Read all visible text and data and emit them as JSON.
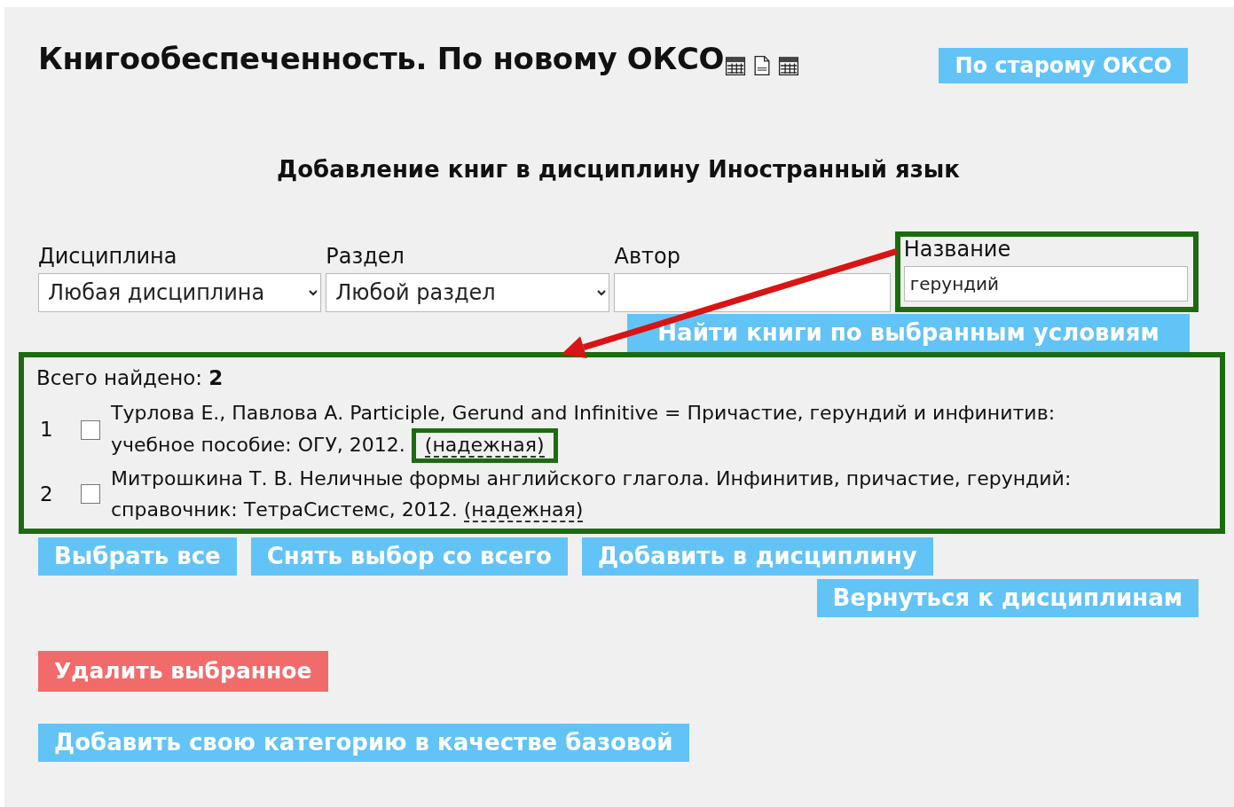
{
  "title": "Книгообеспеченность. По новому ОКСО",
  "old_okso_button": "По старому ОКСО",
  "subtitle": "Добавление книг в дисциплину Иностранный язык",
  "filters": [
    {
      "kind": "select",
      "label": "Дисциплина",
      "value": "Любая дисциплина",
      "highlighted": false
    },
    {
      "kind": "select",
      "label": "Раздел",
      "value": "Любой раздел",
      "highlighted": false
    },
    {
      "kind": "text",
      "label": "Автор",
      "highlighted": false
    },
    {
      "kind": "text",
      "label": "Название",
      "value": "герундий",
      "highlighted": true
    }
  ],
  "search_button": "Найти книги по выбранным условиям",
  "results": {
    "highlighted": true,
    "total_label": "Всего найдено:",
    "total": "2",
    "books": [
      {
        "number": "1",
        "checked": false,
        "text": "Турлова Е., Павлова А. Participle, Gerund and Infinitive = Причастие, герундий и инфинитив: учебное пособие: ОГУ, 2012.",
        "reliability": "(надежная)",
        "highlighted": true
      },
      {
        "number": "2",
        "checked": false,
        "text": "Митрошкина Т. В. Неличные формы английского глагола. Инфинитив, причастие, герундий: справочник: ТетраСистемс, 2012.",
        "reliability": "(надежная)",
        "highlighted": false
      }
    ]
  },
  "action_buttons": [
    "Выбрать все",
    "Снять выбор со всего",
    "Добавить в дисциплину"
  ],
  "return_button": "Вернуться к дисциплинам",
  "delete_button": "Удалить выбранное",
  "add_category_button": "Добавить свою категорию в качестве базовой"
}
